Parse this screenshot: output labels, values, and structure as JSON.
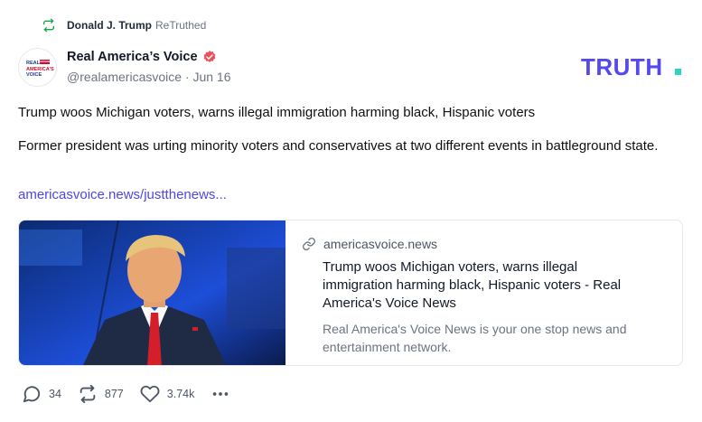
{
  "retruth": {
    "user": "Donald J. Trump",
    "label": "ReTruthed",
    "icon": "retruth-icon",
    "icon_color": "#16a34a"
  },
  "author": {
    "avatar_text": "REAL AMERICA'S VOICE",
    "name": "Real America’s Voice",
    "verified_icon": "verified-badge-icon",
    "verified_color": "#e8505b",
    "meta": "@realamericasvoice · Jun 16"
  },
  "brand": {
    "logo_text": "TRUTH.",
    "logo_color": "#5448ee",
    "dot_color": "#2dd4bf"
  },
  "post": {
    "title": "Trump woos Michigan voters, warns illegal immigration harming black, Hispanic voters",
    "body": "Former president was urting minority voters and conservatives at two different events in battleground state.",
    "link_text": "americasvoice.news/justthenews..."
  },
  "card": {
    "image_icon": "news-photo",
    "link_icon": "link-icon",
    "domain": "americasvoice.news",
    "title": "Trump woos Michigan voters, warns illegal immigration harming black, Hispanic voters - Real America's Voice News",
    "description": "Real America's Voice News is your one stop news and entertainment network."
  },
  "actions": {
    "reply_count": "34",
    "retruth_count": "877",
    "like_count": "3.74k",
    "more_icon": "more-icon"
  }
}
